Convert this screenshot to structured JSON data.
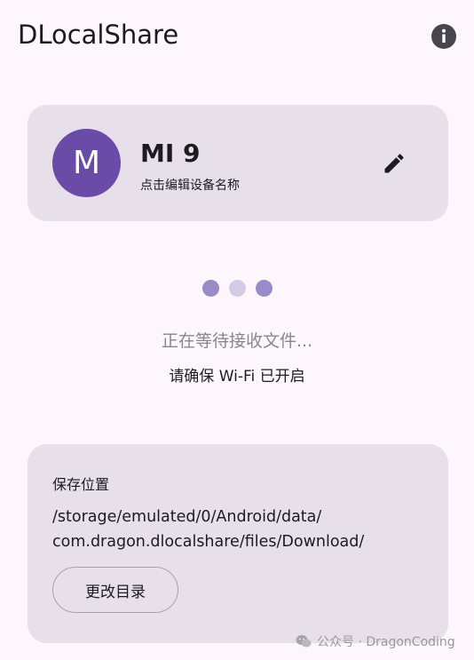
{
  "app": {
    "title": "DLocalShare"
  },
  "device": {
    "avatar_letter": "M",
    "name": "MI 9",
    "hint": "点击编辑设备名称"
  },
  "status": {
    "dots_colors": [
      "#9b8ac8",
      "#d3cbe6",
      "#9b8ac8"
    ],
    "main": "正在等待接收文件...",
    "sub": "请确保 Wi-Fi 已开启"
  },
  "save": {
    "label": "保存位置",
    "path": "/storage/emulated/0/Android/data/\ncom.dragon.dlocalshare/files/Download/",
    "button_label": "更改目录"
  },
  "watermark": {
    "text": "公众号 · DragonCoding"
  },
  "icons": {
    "info": "info-icon",
    "edit": "pencil-icon",
    "watermark": "wechat-icon"
  },
  "colors": {
    "background": "#fdf7fd",
    "card": "#e7e0eb",
    "avatar": "#6a4ba8",
    "text": "#1c1b1f",
    "muted_text": "#8a8590"
  }
}
